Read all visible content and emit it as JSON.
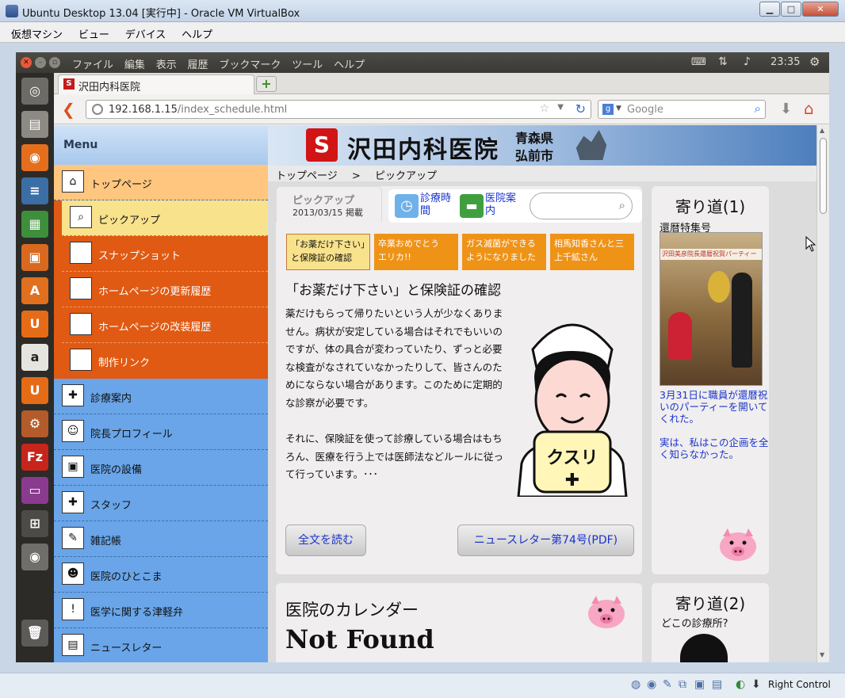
{
  "vbox": {
    "title": "Ubuntu Desktop 13.04 [実行中] - Oracle VM VirtualBox",
    "menu": [
      "仮想マシン",
      "ビュー",
      "デバイス",
      "ヘルプ"
    ],
    "host_key": "Right Control"
  },
  "ubuntu": {
    "menus": [
      "ファイル",
      "編集",
      "表示",
      "履歴",
      "ブックマーク",
      "ツール",
      "ヘルプ"
    ],
    "clock": "23:35"
  },
  "browser": {
    "tab_title": "沢田内科医院",
    "url_host": "192.168.1.15",
    "url_path": "/index_schedule.html",
    "search_placeholder": "Google"
  },
  "site": {
    "banner": {
      "name": "沢田内科医院",
      "pref": "青森県",
      "city": "弘前市"
    },
    "breadcrumb": {
      "home": "トップページ",
      "sep": ">",
      "current": "ピックアップ"
    },
    "menu_title": "Menu",
    "menu_items": [
      {
        "label": "トップページ",
        "icon": "house-icon"
      },
      {
        "label": "ピックアップ",
        "icon": "magnifier-icon"
      },
      {
        "label": "スナップショット",
        "icon": "camera-icon"
      },
      {
        "label": "ホームページの更新履歴",
        "icon": "brush-icon"
      },
      {
        "label": "ホームページの改装履歴",
        "icon": "hammer-icon"
      },
      {
        "label": "制作リンク",
        "icon": "link-icon"
      },
      {
        "label": "診療案内",
        "icon": "ambulance-icon"
      },
      {
        "label": "院長プロフィール",
        "icon": "doctor-icon"
      },
      {
        "label": "医院の設備",
        "icon": "equipment-icon"
      },
      {
        "label": "スタッフ",
        "icon": "nurse-icon"
      },
      {
        "label": "雑記帳",
        "icon": "notebook-icon"
      },
      {
        "label": "医院のひとこま",
        "icon": "person-icon"
      },
      {
        "label": "医学に関する津軽弁",
        "icon": "exclamation-icon"
      },
      {
        "label": "ニュースレター",
        "icon": "newsletter-icon"
      }
    ],
    "pickup": {
      "tab_title": "ピックアップ",
      "date": "2013/03/15 掲載",
      "nav1": "診療時間",
      "nav2": "医院案内"
    },
    "news_tabs": [
      {
        "line1": "「お薬だけ下さい」",
        "line2": "と保険証の確認"
      },
      {
        "line1": "卒業おめでとう",
        "line2": "エリカ!!"
      },
      {
        "line1": "ガス滅菌ができる",
        "line2": "ようになりました"
      },
      {
        "line1": "相馬知香さんと三",
        "line2": "上千絋さん"
      }
    ],
    "article": {
      "title": "「お薬だけ下さい」と保険証の確認",
      "p1": "薬だけもらって帰りたいという人が少なくありません。病状が安定している場合はそれでもいいのですが、体の具合が変わっていたり、ずっと必要な検査がなされていなかったりして、皆さんのためにならない場合があります。このために定期的な診察が必要です。",
      "p2": "それに、保険証を使って診療している場合はもちろん、医療を行う上では医師法などルールに従って行っています。･･･",
      "read_more": "全文を読む",
      "newsletter": "ニュースレター第74号(PDF)",
      "bag_text": "クスリ"
    },
    "yorimichi1": {
      "title": "寄り道(1)",
      "subtitle": "還暦特集号",
      "photo_text": "沢田美彦院長還暦祝賀パーティー",
      "caption1": "3月31日に職員が還暦祝いのパーティーを開いてくれた。",
      "caption2": "実は、私はこの企画を全く知らなかった。"
    },
    "calendar": {
      "title": "医院のカレンダー",
      "not_found": "Not Found"
    },
    "yorimichi2": {
      "title": "寄り道(2)",
      "subtitle": "どこの診療所?"
    }
  },
  "colors": {
    "menu_blue": "#69a5e8",
    "menu_orange": "#e05a13",
    "menu_active": "#f8e28c",
    "menu_top": "#ffc680",
    "news_tab": "#ef9317",
    "link": "#1a33cc"
  }
}
